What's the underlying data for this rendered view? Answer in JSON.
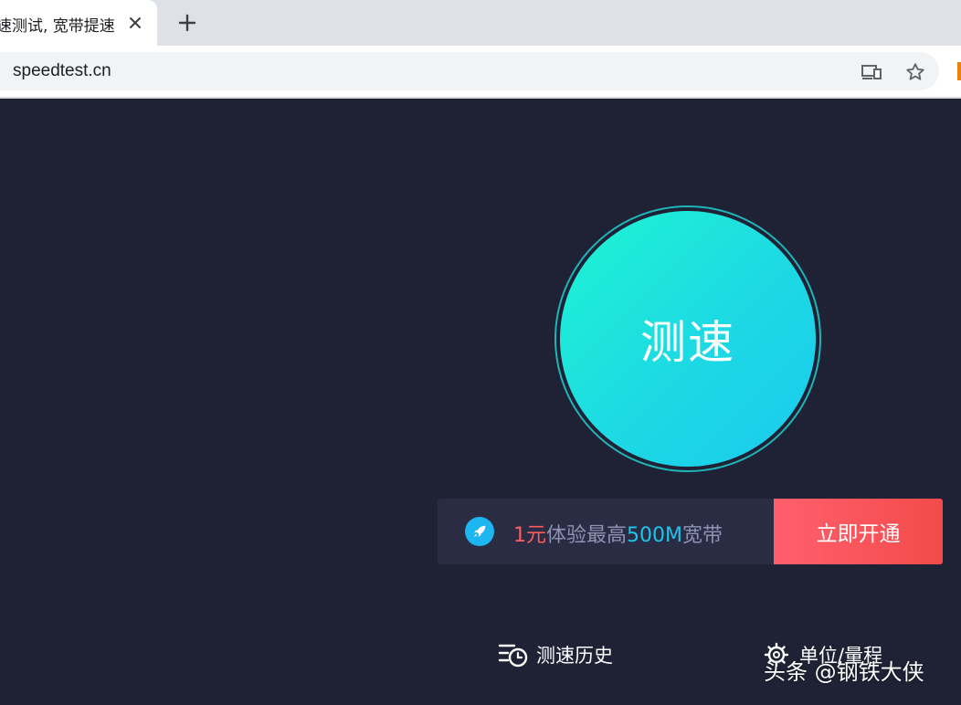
{
  "browser": {
    "tab_title": "速测试, 宽带提速",
    "url": "speedtest.cn"
  },
  "speedtest": {
    "start_label": "测速"
  },
  "promo": {
    "price": "1元",
    "text_mid": "体验最高",
    "speed": "500M",
    "text_end": "宽带",
    "button_label": "立即开通"
  },
  "footer": {
    "history_label": "测速历史",
    "unit_label": "单位/量程"
  },
  "watermark": "头条 @钢铁大侠",
  "colors": {
    "background": "#1f2135",
    "accent_cyan": "#1fc4ea",
    "accent_red": "#ff5b5b"
  },
  "icons": [
    "close-icon",
    "plus-icon",
    "cast-icon",
    "star-icon",
    "rocket-icon",
    "history-icon",
    "gear-icon"
  ]
}
